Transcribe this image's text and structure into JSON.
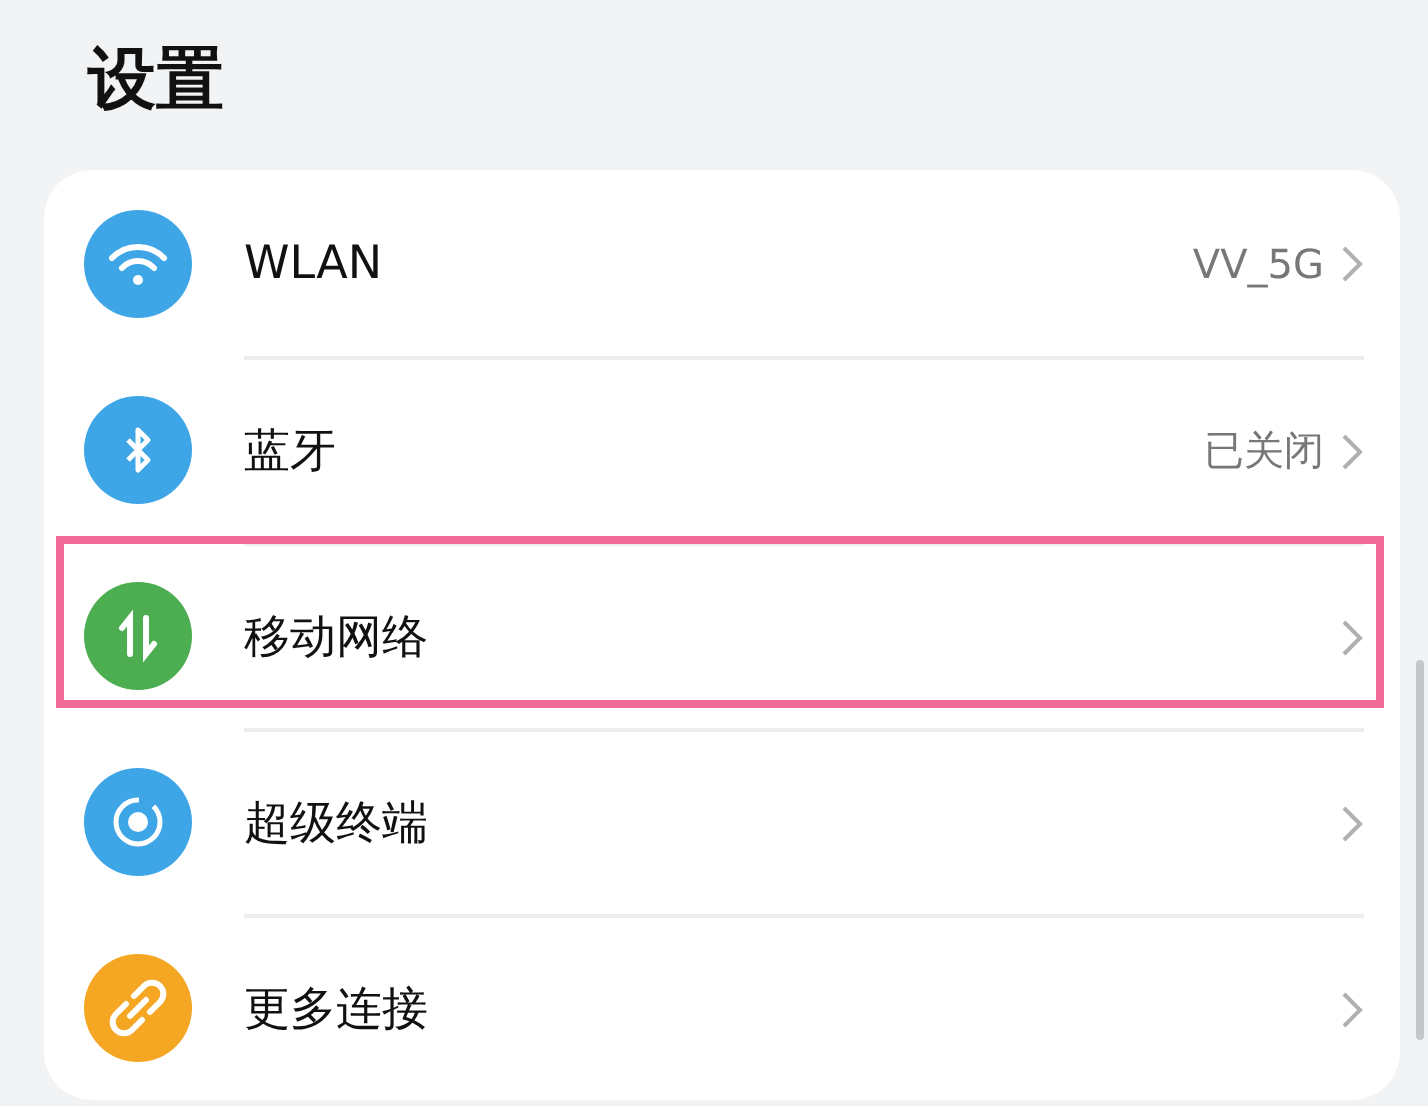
{
  "title": "设置",
  "items": [
    {
      "label": "WLAN",
      "value": "VV_5G",
      "color": "#3ea6e6",
      "highlighted": false
    },
    {
      "label": "蓝牙",
      "value": "已关闭",
      "color": "#3ea6e6",
      "highlighted": false
    },
    {
      "label": "移动网络",
      "color": "#4cae50",
      "highlighted": true
    },
    {
      "label": "超级终端",
      "color": "#3ea6e6",
      "highlighted": false
    },
    {
      "label": "更多连接",
      "color": "#f5a623",
      "highlighted": false
    }
  ]
}
